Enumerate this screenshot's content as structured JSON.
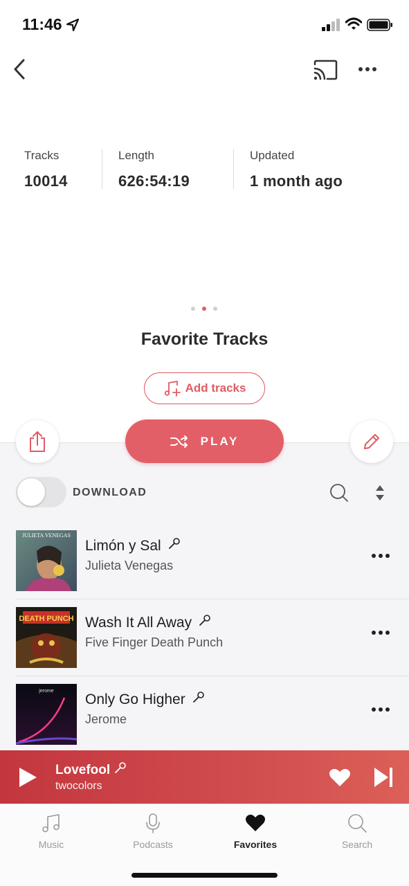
{
  "status_bar": {
    "time": "11:46"
  },
  "stats": [
    {
      "label": "Tracks",
      "value": "10014"
    },
    {
      "label": "Length",
      "value": "626:54:19"
    },
    {
      "label": "Updated",
      "value": "1 month ago"
    }
  ],
  "playlist": {
    "title": "Favorite Tracks",
    "add_tracks_label": "Add tracks",
    "play_label": "PLAY",
    "page_indicator": {
      "count": 3,
      "active_index": 1
    }
  },
  "download": {
    "label": "DOWNLOAD",
    "enabled": false
  },
  "tracks": [
    {
      "title": "Limón y Sal",
      "artist": "Julieta Venegas",
      "art_text": "JULIETA VENEGAS"
    },
    {
      "title": "Wash It All Away",
      "artist": "Five Finger Death Punch",
      "art_text": "DEATH PUNCH"
    },
    {
      "title": "Only Go Higher",
      "artist": "Jerome",
      "art_text": "jerome"
    }
  ],
  "now_playing": {
    "title": "Lovefool",
    "artist": "twocolors"
  },
  "tabs": [
    {
      "label": "Music",
      "icon": "music-note-icon",
      "active": false
    },
    {
      "label": "Podcasts",
      "icon": "microphone-icon",
      "active": false
    },
    {
      "label": "Favorites",
      "icon": "heart-icon",
      "active": true
    },
    {
      "label": "Search",
      "icon": "search-icon",
      "active": false
    }
  ],
  "colors": {
    "accent": "#e35f68",
    "player_bg": "#c83e44"
  }
}
